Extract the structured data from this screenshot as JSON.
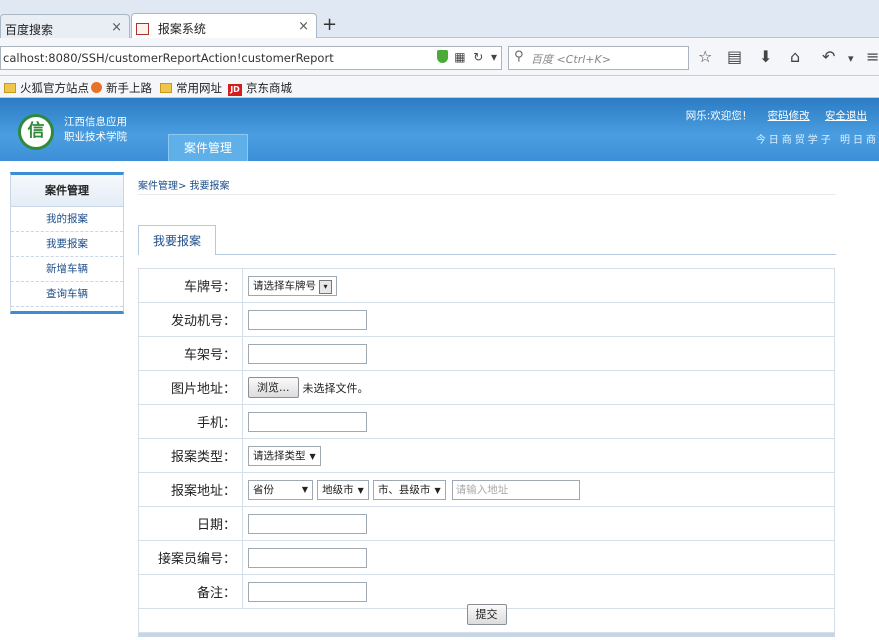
{
  "browser": {
    "tabs": [
      {
        "label": "百度搜索",
        "close": "×"
      },
      {
        "label": "报案系统",
        "close": "×"
      }
    ],
    "new_tab": "+",
    "url": "calhost:8080/SSH/customerReportAction!customerReport",
    "search_placeholder": "百度 <Ctrl+K>",
    "bookmarks": [
      {
        "label": "火狐官方站点",
        "icon": "folder-icon"
      },
      {
        "label": "新手上路",
        "icon": "firefox-icon"
      },
      {
        "label": "常用网址",
        "icon": "folder-icon"
      },
      {
        "label": "京东商城",
        "icon": "jd-icon"
      }
    ]
  },
  "header": {
    "logo_char": "信",
    "school_line1": "江西信息应用",
    "school_line2": "职业技术学院",
    "module_tab": "案件管理",
    "welcome": "网乐:欢迎您！",
    "change_password": "密码修改",
    "logout": "安全退出",
    "slogan": "今日商贸学子   明日商"
  },
  "sidebar": {
    "title": "案件管理",
    "items": [
      {
        "label": "我的报案"
      },
      {
        "label": "我要报案"
      },
      {
        "label": "新增车辆"
      },
      {
        "label": "查询车辆"
      }
    ]
  },
  "breadcrumb": "案件管理> 我要报案",
  "form_tab": "我要报案",
  "form": {
    "plate_label": "车牌号：",
    "plate_select": "请选择车牌号",
    "engine_label": "发动机号：",
    "frame_label": "车架号：",
    "image_label": "图片地址：",
    "browse_button": "浏览...",
    "no_file": "未选择文件。",
    "phone_label": "手机：",
    "type_label": "报案类型：",
    "type_select": "请选择类型",
    "address_label": "报案地址：",
    "province": "省份",
    "city": "地级市",
    "county": "市、县级市",
    "address_placeholder": "请输入地址",
    "date_label": "日期：",
    "officer_label": "接案员编号：",
    "remark_label": "备注：",
    "submit": "提交"
  }
}
